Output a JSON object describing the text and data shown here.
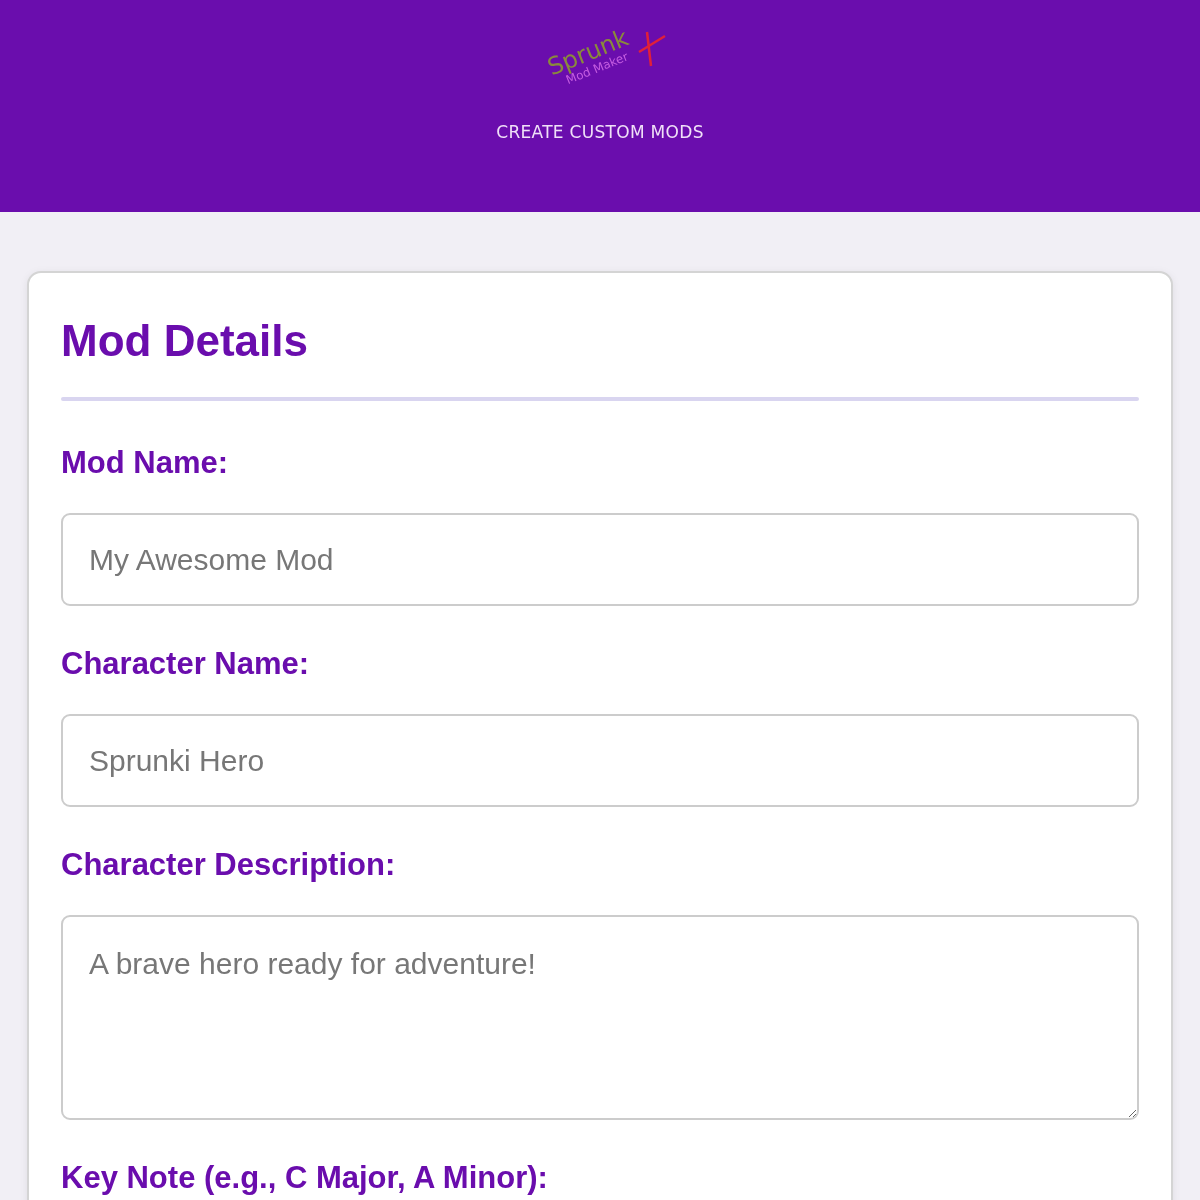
{
  "header": {
    "logo": {
      "word": "Sprunk",
      "subtitle": "Mod Maker"
    },
    "tagline": "CREATE CUSTOM MODS"
  },
  "card": {
    "title": "Mod Details",
    "fields": [
      {
        "kind": "input",
        "label": "Mod Name:",
        "placeholder": "My Awesome Mod"
      },
      {
        "kind": "input",
        "label": "Character Name:",
        "placeholder": "Sprunki Hero"
      },
      {
        "kind": "textarea",
        "label": "Character Description:",
        "placeholder": "A brave hero ready for adventure!"
      },
      {
        "kind": "label",
        "label": "Key Note (e.g., C Major, A Minor):"
      }
    ]
  }
}
